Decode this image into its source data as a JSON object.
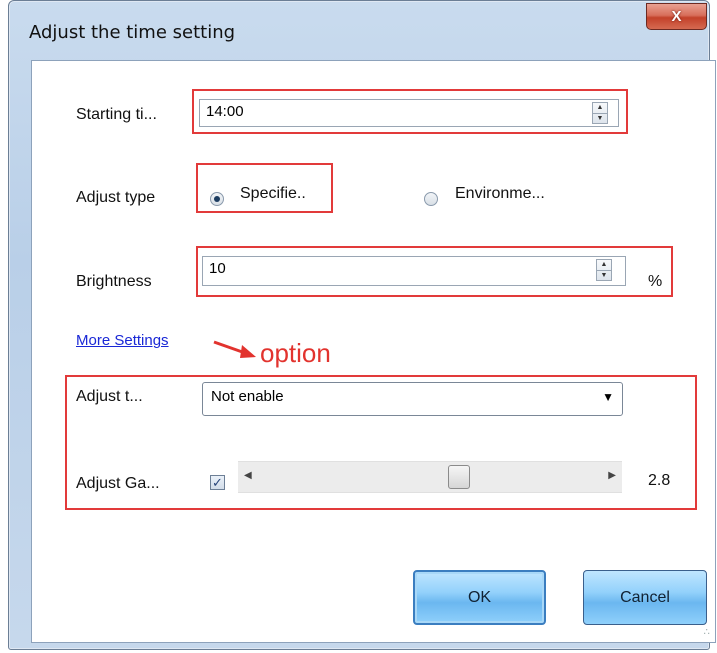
{
  "window": {
    "title": "Adjust the time setting",
    "close_label": "X"
  },
  "starting_time": {
    "label": "Starting ti...",
    "value": "14:00"
  },
  "adjust_type": {
    "label": "Adjust type",
    "options": [
      {
        "label": "Specifie..",
        "selected": true
      },
      {
        "label": "Environme...",
        "selected": false
      }
    ]
  },
  "brightness": {
    "label": "Brightness",
    "value": "10",
    "unit": "%"
  },
  "more_settings": {
    "link_label": "More Settings",
    "annotation": "option"
  },
  "adjust_t": {
    "label": "Adjust t...",
    "selected": "Not enable"
  },
  "adjust_gamma": {
    "label": "Adjust Ga...",
    "checked": true,
    "value_text": "2.8",
    "slider_fraction": 0.59
  },
  "buttons": {
    "ok": "OK",
    "cancel": "Cancel"
  },
  "colors": {
    "highlight_red": "#e23a3a",
    "link_blue": "#1a28d6",
    "button_blue": "#6bb7f0"
  },
  "icons": [
    "close-icon",
    "spinner-up-icon",
    "spinner-down-icon",
    "dropdown-arrow-icon",
    "checkmark-icon",
    "slider-left-arrow-icon",
    "slider-right-arrow-icon",
    "annotation-arrow-icon",
    "resize-grip-icon"
  ]
}
